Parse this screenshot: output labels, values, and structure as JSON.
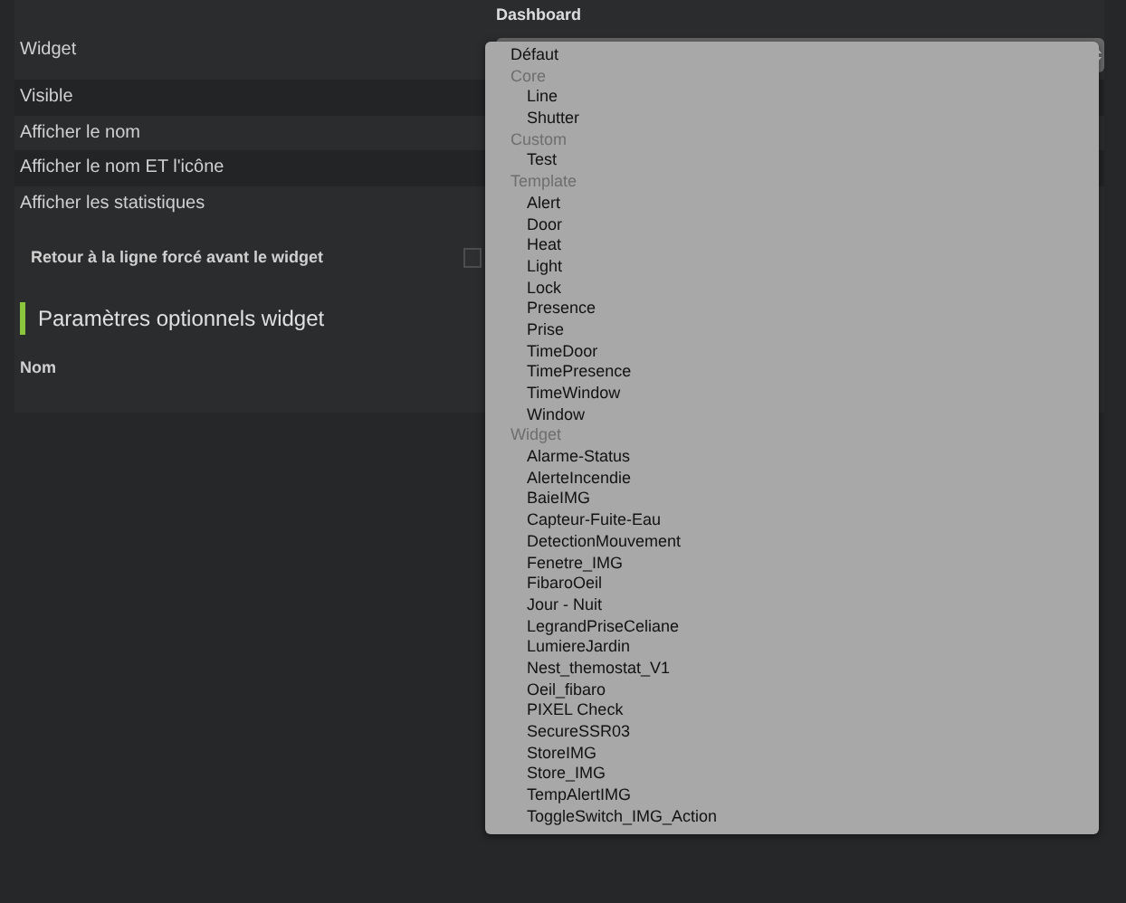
{
  "widget_field": {
    "label": "Widget",
    "section": "Dashboard"
  },
  "display_rows": [
    {
      "label": "Visible"
    },
    {
      "label": "Afficher le nom"
    },
    {
      "label": "Afficher le nom ET l'icône"
    },
    {
      "label": "Afficher les statistiques"
    }
  ],
  "line_break": {
    "label": "Retour à la ligne forcé avant le widget",
    "checked": false
  },
  "optional_section": {
    "title": "Paramètres optionnels widget",
    "fields": [
      {
        "label": "Nom"
      }
    ]
  },
  "dropdown": [
    {
      "kind": "option",
      "label": "Défaut"
    },
    {
      "kind": "group",
      "label": "Core",
      "children": [
        {
          "label": "Line"
        },
        {
          "label": "Shutter"
        }
      ]
    },
    {
      "kind": "group",
      "label": "Custom",
      "children": [
        {
          "label": "Test"
        }
      ]
    },
    {
      "kind": "group",
      "label": "Template",
      "children": [
        {
          "label": "Alert"
        },
        {
          "label": "Door"
        },
        {
          "label": "Heat"
        },
        {
          "label": "Light"
        },
        {
          "label": "Lock"
        },
        {
          "label": "Presence"
        },
        {
          "label": "Prise"
        },
        {
          "label": "TimeDoor"
        },
        {
          "label": "TimePresence"
        },
        {
          "label": "TimeWindow"
        },
        {
          "label": "Window"
        }
      ]
    },
    {
      "kind": "group",
      "label": "Widget",
      "children": [
        {
          "label": "Alarme-Status"
        },
        {
          "label": "AlerteIncendie"
        },
        {
          "label": "BaieIMG"
        },
        {
          "label": "Capteur-Fuite-Eau"
        },
        {
          "label": "DetectionMouvement"
        },
        {
          "label": "Fenetre_IMG"
        },
        {
          "label": "FibaroOeil"
        },
        {
          "label": "Jour - Nuit"
        },
        {
          "label": "LegrandPriseCeliane"
        },
        {
          "label": "LumiereJardin"
        },
        {
          "label": "Nest_themostat_V1"
        },
        {
          "label": "Oeil_fibaro"
        },
        {
          "label": "PIXEL Check"
        },
        {
          "label": "SecureSSR03"
        },
        {
          "label": "StoreIMG"
        },
        {
          "label": "Store_IMG"
        },
        {
          "label": "TempAlertIMG"
        },
        {
          "label": "ToggleSwitch_IMG_Action"
        }
      ]
    }
  ]
}
